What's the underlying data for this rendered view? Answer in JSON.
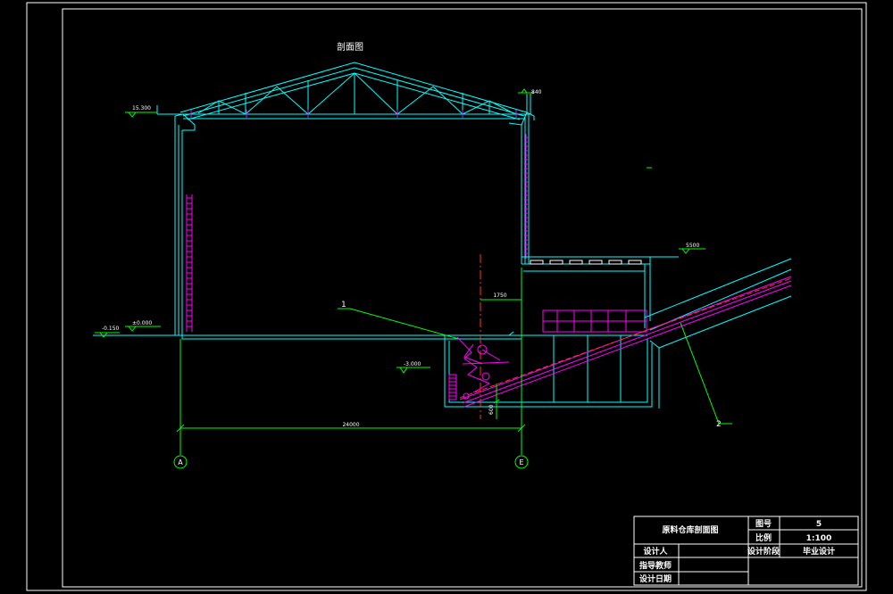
{
  "drawing": {
    "title": "剖面图",
    "levels": {
      "ridge_left": "15.300",
      "right_top": "840",
      "ground_left": "-0.150",
      "ground_zero": "±0.000",
      "pit": "-3.000",
      "annex": "5500"
    },
    "dimensions": {
      "span": "24000",
      "offset": "1750",
      "pit_depth": "600"
    },
    "axes": {
      "left": "A",
      "right": "E"
    },
    "callouts": {
      "one": "1",
      "two": "2"
    }
  },
  "title_block": {
    "name": "原料仓库剖面图",
    "drawing_no_label": "图号",
    "drawing_no": "5",
    "scale_label": "比例",
    "scale": "1:100",
    "designer_label": "设计人",
    "stage_label": "设计阶段",
    "stage": "毕业设计",
    "advisor_label": "指导教师",
    "date_label": "设计日期"
  },
  "colors": {
    "structure": "#00ffff",
    "axis": "#00ff00",
    "magenta": "#ff00ff",
    "red": "#ff3030",
    "frame": "#ffffff"
  }
}
